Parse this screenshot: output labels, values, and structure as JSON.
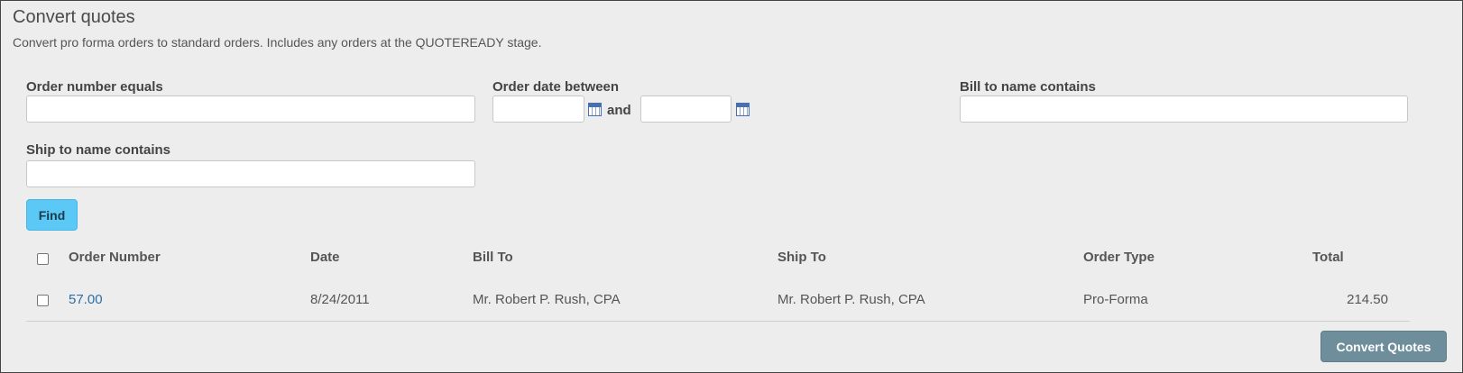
{
  "header": {
    "title": "Convert quotes",
    "description": "Convert pro forma orders to standard orders. Includes any orders at the QUOTEREADY stage."
  },
  "filters": {
    "order_number_label": "Order number equals",
    "order_number_value": "",
    "order_date_label": "Order date between",
    "date_from_value": "",
    "date_and_label": "and",
    "date_to_value": "",
    "bill_to_label": "Bill to name contains",
    "bill_to_value": "",
    "ship_to_label": "Ship to name contains",
    "ship_to_value": "",
    "find_button": "Find"
  },
  "table": {
    "columns": [
      "Order Number",
      "Date",
      "Bill To",
      "Ship To",
      "Order Type",
      "Total"
    ],
    "rows": [
      {
        "checked": false,
        "order_number": "57.00",
        "date": "8/24/2011",
        "bill_to": "Mr. Robert P. Rush, CPA",
        "ship_to": "Mr. Robert P. Rush, CPA",
        "order_type": "Pro-Forma",
        "total": "214.50"
      }
    ]
  },
  "actions": {
    "convert_button": "Convert Quotes"
  },
  "icons": {
    "date_from_picker": "calendar-icon",
    "date_to_picker": "calendar-icon"
  },
  "colors": {
    "find_button": "#5bc8f5",
    "convert_button": "#6f8e9b",
    "link": "#2a6fa8",
    "panel_background": "#ededed"
  }
}
